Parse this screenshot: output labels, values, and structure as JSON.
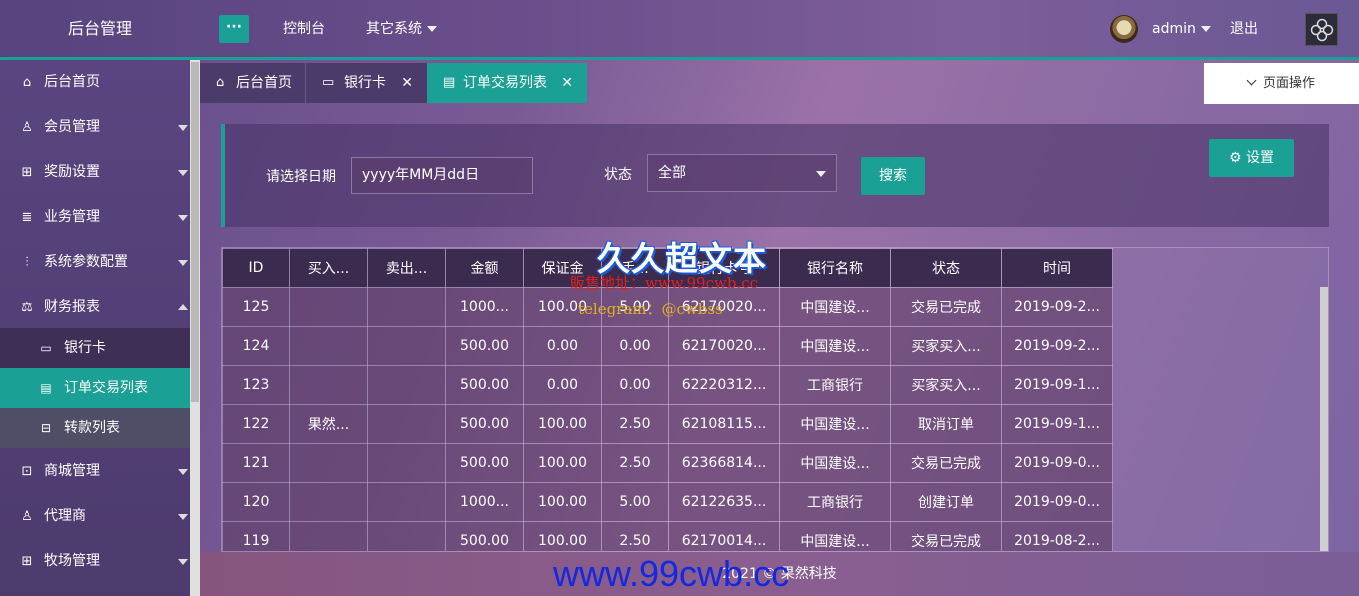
{
  "header": {
    "logo": "后台管理",
    "menu_toggle": "···",
    "nav_console": "控制台",
    "nav_other": "其它系统",
    "user": "admin",
    "logout": "退出"
  },
  "sidebar": {
    "items": [
      {
        "label": "后台首页",
        "icon": "home-icon"
      },
      {
        "label": "会员管理",
        "icon": "user-icon"
      },
      {
        "label": "奖励设置",
        "icon": "gift-icon"
      },
      {
        "label": "业务管理",
        "icon": "list-icon"
      },
      {
        "label": "系统参数配置",
        "icon": "sliders-icon"
      },
      {
        "label": "财务报表",
        "icon": "chart-icon"
      },
      {
        "label": "商城管理",
        "icon": "store-icon"
      },
      {
        "label": "代理商",
        "icon": "agent-icon"
      },
      {
        "label": "牧场管理",
        "icon": "ranch-icon"
      }
    ],
    "subitems": [
      {
        "label": "银行卡",
        "icon": "card-icon"
      },
      {
        "label": "订单交易列表",
        "icon": "document-icon"
      },
      {
        "label": "转款列表",
        "icon": "transfer-icon"
      }
    ]
  },
  "tabs": [
    {
      "label": "后台首页",
      "closable": false
    },
    {
      "label": "银行卡",
      "closable": true
    },
    {
      "label": "订单交易列表",
      "closable": true,
      "active": true
    }
  ],
  "page_ops": "页面操作",
  "search": {
    "date_label": "请选择日期",
    "date_placeholder": "yyyy年MM月dd日",
    "status_label": "状态",
    "status_value": "全部",
    "search_button": "搜索",
    "settings_button": "设置"
  },
  "table": {
    "columns": [
      "ID",
      "买入...",
      "卖出...",
      "金额",
      "保证金",
      "手...",
      "银行卡号",
      "银行名称",
      "状态",
      "时间"
    ],
    "rows": [
      [
        "125",
        "",
        "",
        "1000...",
        "100.00",
        "5.00",
        "62170020...",
        "中国建设...",
        "交易已完成",
        "2019-09-2..."
      ],
      [
        "124",
        "",
        "",
        "500.00",
        "0.00",
        "0.00",
        "62170020...",
        "中国建设...",
        "买家买入...",
        "2019-09-2..."
      ],
      [
        "123",
        "",
        "",
        "500.00",
        "0.00",
        "0.00",
        "62220312...",
        "工商银行",
        "买家买入...",
        "2019-09-1..."
      ],
      [
        "122",
        "果然...",
        "",
        "500.00",
        "100.00",
        "2.50",
        "62108115...",
        "中国建设...",
        "取消订单",
        "2019-09-1..."
      ],
      [
        "121",
        "",
        "",
        "500.00",
        "100.00",
        "2.50",
        "62366814...",
        "中国建设...",
        "交易已完成",
        "2019-09-0..."
      ],
      [
        "120",
        "",
        "",
        "1000...",
        "100.00",
        "5.00",
        "62122635...",
        "工商银行",
        "创建订单",
        "2019-09-0..."
      ],
      [
        "119",
        "",
        "",
        "500.00",
        "100.00",
        "2.50",
        "62170014...",
        "中国建设...",
        "交易已完成",
        "2019-08-2..."
      ]
    ]
  },
  "footer": "2021 © 果然科技",
  "watermarks": {
    "title": "久久超文本",
    "red_line": "販售地址：www.99cwb.cc",
    "tg_line": "telegram：@cwbss",
    "site": "www.99cwb.cc"
  },
  "colors": {
    "accent": "#1aa094",
    "sidebar": "#4c3b6d",
    "table_header": "#3b2b4f"
  }
}
